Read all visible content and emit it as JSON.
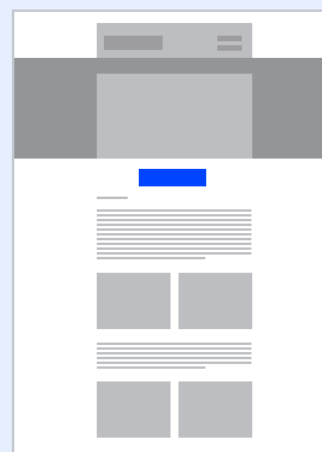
{
  "wireframe": {
    "title": "",
    "colors": {
      "page_background": "#e6effd",
      "frame_background": "#ffffff",
      "frame_border": "#c3c7d0",
      "header_bar": "#bdbec2",
      "logo_placeholder": "#9c9ca1",
      "hero_band": "#949599",
      "hero_image": "#bdbec2",
      "cta_button": "#0044ff",
      "text_placeholder": "#bdbec2",
      "image_placeholder": "#bdbec2"
    },
    "header": {
      "logo": "logo-placeholder",
      "menu_icon": "hamburger-menu-icon"
    },
    "hero": {
      "image": "image-placeholder"
    },
    "cta": {
      "label": ""
    },
    "sections": [
      {
        "heading": "short-text-placeholder",
        "paragraph_lines": 12,
        "image_grid": [
          "image-placeholder",
          "image-placeholder"
        ]
      },
      {
        "paragraph_lines": 6,
        "image_grid": [
          "image-placeholder",
          "image-placeholder"
        ]
      }
    ]
  }
}
